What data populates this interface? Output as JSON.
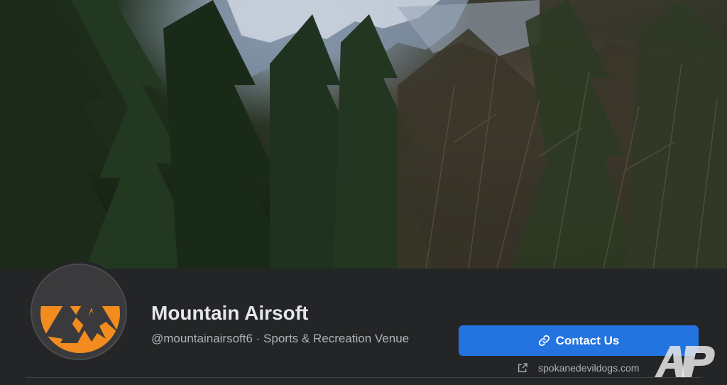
{
  "cover": {
    "icon": "cover-photo-forest-mountains"
  },
  "profile": {
    "name": "Mountain Airsoft",
    "subtitle": "@mountainairsoft6 · Sports & Recreation Venue",
    "avatar_icon": "mountain-logo-icon",
    "avatar_bg": "#f28c1e"
  },
  "actions": {
    "contact_label": "Contact Us",
    "contact_icon": "link-icon",
    "button_color": "#2374e1"
  },
  "website": {
    "icon": "external-link-icon",
    "text": "spokanedevildogs.com"
  },
  "watermark": {
    "text": "AP"
  }
}
